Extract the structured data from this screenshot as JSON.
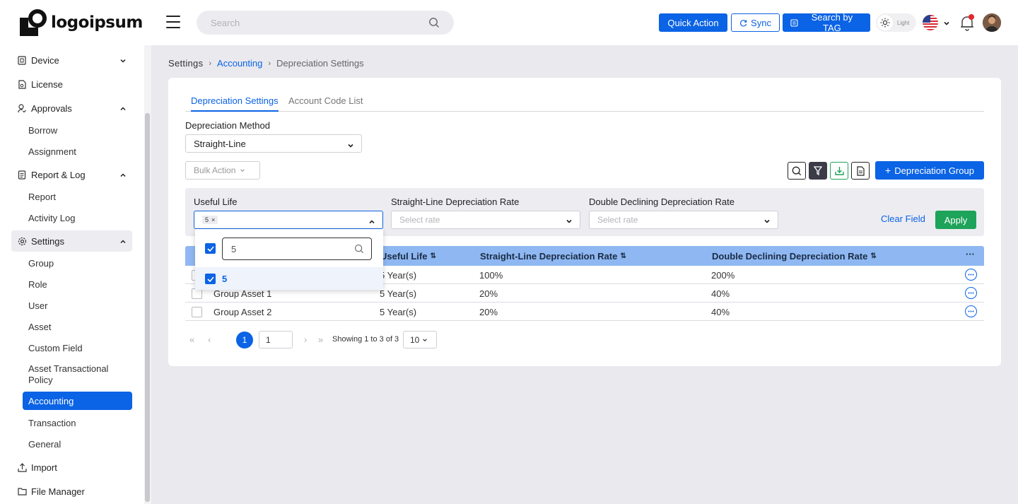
{
  "header": {
    "logo_text": "logoipsum",
    "search_placeholder": "Search",
    "quick_action": "Quick Action",
    "sync": "Sync",
    "search_by_tag": "Search by TAG",
    "theme_label": "Light",
    "colors": {
      "primary": "#0b63e5",
      "success": "#1ea35a",
      "notification": "#e3262b"
    }
  },
  "sidebar": {
    "items": [
      {
        "label": "Device",
        "icon": "device-icon",
        "chevron": "down"
      },
      {
        "label": "License",
        "icon": "license-icon"
      },
      {
        "label": "Approvals",
        "icon": "approvals-icon",
        "chevron": "up"
      },
      {
        "label": "Report & Log",
        "icon": "report-icon",
        "chevron": "up"
      },
      {
        "label": "Settings",
        "icon": "gear-icon",
        "chevron": "up"
      },
      {
        "label": "Import",
        "icon": "import-icon"
      },
      {
        "label": "File Manager",
        "icon": "folder-icon"
      }
    ],
    "approvals_sub": [
      "Borrow",
      "Assignment"
    ],
    "report_sub": [
      "Report",
      "Activity Log"
    ],
    "settings_sub": [
      "Group",
      "Role",
      "User",
      "Asset",
      "Custom Field",
      "Asset Transactional Policy",
      "Accounting",
      "Transaction",
      "General"
    ],
    "active_sub": "Accounting"
  },
  "breadcrumb": {
    "root": "Settings",
    "link": "Accounting",
    "current": "Depreciation Settings"
  },
  "tabs": {
    "active": "Depreciation Settings",
    "inactive": "Account Code List"
  },
  "method": {
    "label": "Depreciation Method",
    "value": "Straight-Line"
  },
  "toolbar": {
    "bulk_action": "Bulk Action",
    "add_group": "Depreciation Group"
  },
  "filters": {
    "useful_life_label": "Useful Life",
    "useful_life_chip": "5",
    "sl_rate_label": "Straight-Line Depreciation Rate",
    "sl_rate_placeholder": "Select rate",
    "ddb_rate_label": "Double Declining Depreciation Rate",
    "ddb_rate_placeholder": "Select rate",
    "clear": "Clear Field",
    "apply": "Apply"
  },
  "dropdown": {
    "search_value": "5",
    "option": "5",
    "option_checked": true,
    "select_all_checked": true
  },
  "table": {
    "columns": [
      "Useful Life",
      "Straight-Line Depreciation Rate",
      "Double Declining Depreciation Rate"
    ],
    "more_label": "···",
    "rows": [
      {
        "name": "",
        "life": "5 Year(s)",
        "sl": "100%",
        "ddb": "200%"
      },
      {
        "name": "Group Asset 1",
        "life": "5 Year(s)",
        "sl": "20%",
        "ddb": "40%"
      },
      {
        "name": "Group Asset 2",
        "life": "5 Year(s)",
        "sl": "20%",
        "ddb": "40%"
      }
    ]
  },
  "pagination": {
    "current_page": "1",
    "page_input": "1",
    "info": "Showing 1 to 3 of 3",
    "page_size": "10"
  }
}
